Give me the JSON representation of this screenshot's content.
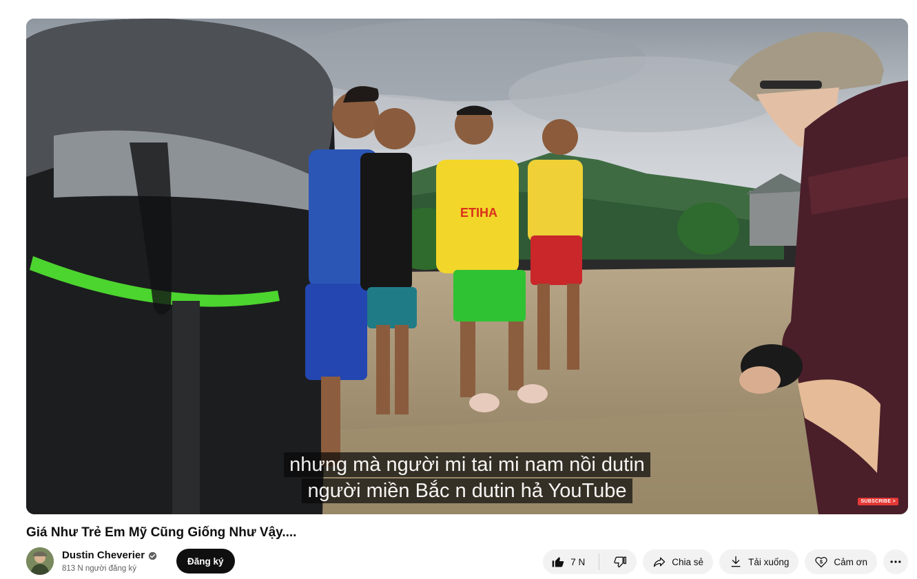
{
  "video": {
    "captions": [
      "nhưng mà người mi tai mi nam nồi dutin",
      "người miền Bắc n dutin hả YouTube"
    ],
    "watermark_label": "SUBSCRIBE >"
  },
  "info": {
    "title": "Giá Như Trẻ Em Mỹ Cũng Giống Như Vậy....",
    "channel_name": "Dustin Cheverier",
    "subscriber_count": "813 N người đăng ký",
    "subscribe_label": "Đăng ký"
  },
  "actions": {
    "like_count": "7 N",
    "share_label": "Chia sẻ",
    "download_label": "Tải xuống",
    "thanks_label": "Cảm ơn"
  },
  "icons": {
    "like": "thumbs-up-icon",
    "dislike": "thumbs-down-icon",
    "share": "share-arrow-icon",
    "download": "download-icon",
    "thanks": "dollar-heart-icon",
    "more": "more-horizontal-icon",
    "verified": "verified-check-icon"
  },
  "colors": {
    "subscribe_bg": "#0f0f0f",
    "pill_bg": "#f2f2f2",
    "caption_bg": "#080808"
  }
}
